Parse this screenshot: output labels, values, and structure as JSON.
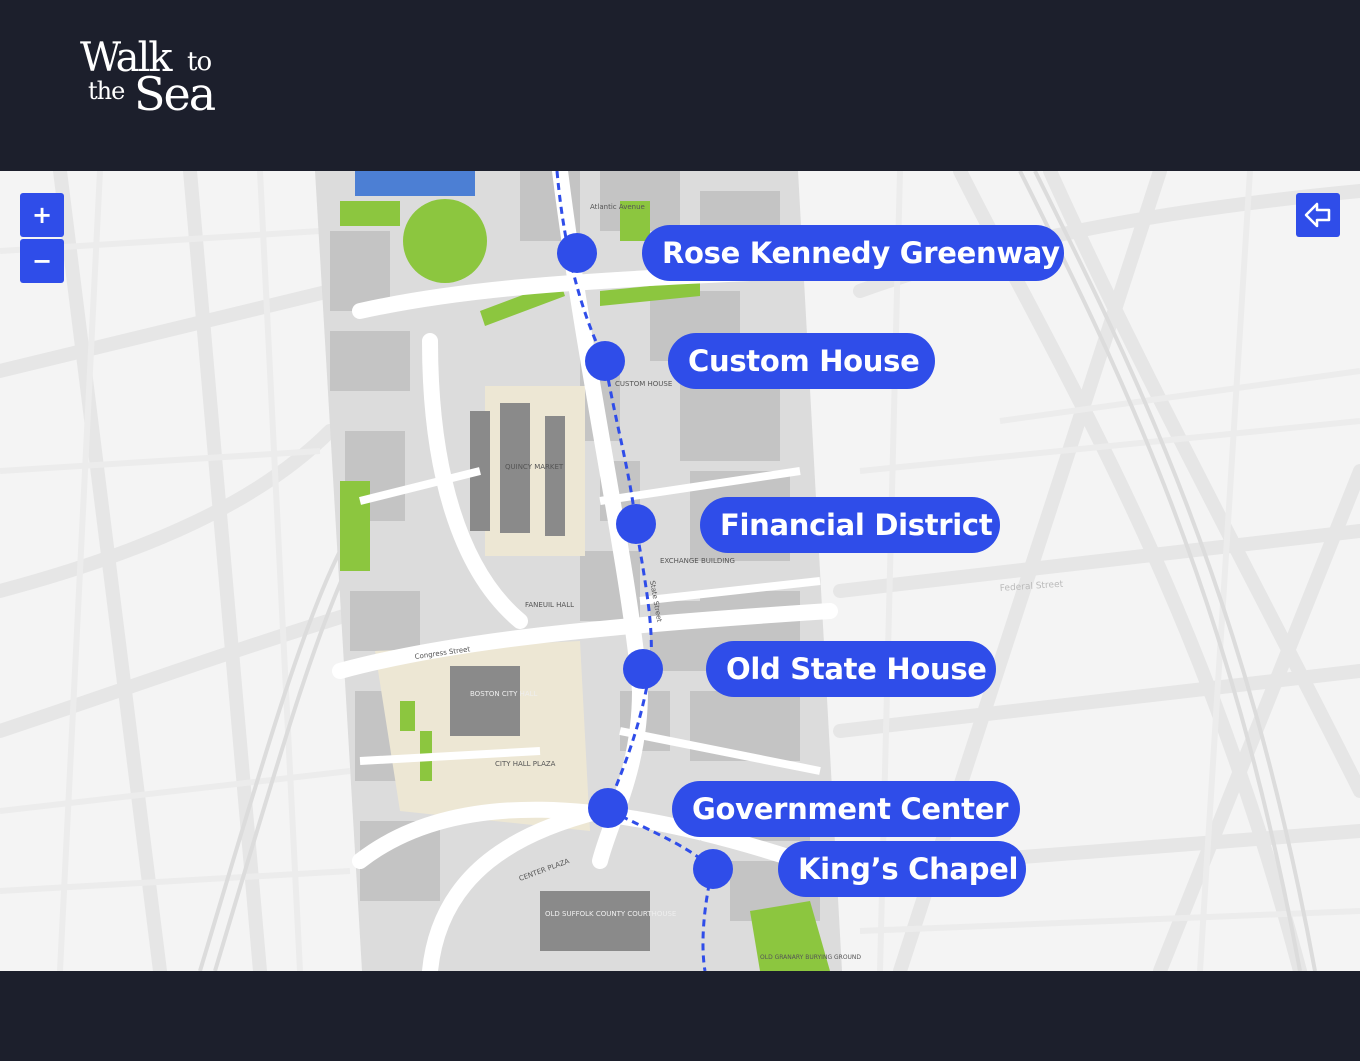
{
  "brand": {
    "logo_word_walk": "Walk",
    "logo_word_to": "to",
    "logo_word_the": "the",
    "logo_word_sea": "Sea"
  },
  "map_controls": {
    "zoom_in": "+",
    "zoom_out": "−"
  },
  "stops": [
    {
      "label": "Rose Kennedy Greenway"
    },
    {
      "label": "Custom House"
    },
    {
      "label": "Financial District"
    },
    {
      "label": "Old State House"
    },
    {
      "label": "Government Center"
    },
    {
      "label": "King’s Chapel"
    }
  ],
  "map_labels": {
    "quincy_market": "QUINCY MARKET",
    "faneuil_hall": "FANEUIL HALL",
    "boston_city_hall": "BOSTON CITY HALL",
    "city_hall_plaza": "CITY HALL PLAZA",
    "exchange_building": "EXCHANGE BUILDING",
    "custom_house": "CUSTOM HOUSE",
    "old_suffolk_courthouse": "OLD SUFFOLK COUNTY COURTHOUSE",
    "congress_street": "Congress Street",
    "state_street": "State Street",
    "atlantic_avenue": "Atlantic Avenue",
    "federal_street": "Federal Street",
    "center_plaza": "CENTER PLAZA",
    "old_granary": "OLD GRANARY BURYING GROUND"
  },
  "colors": {
    "accent": "#2f4de9",
    "header_bg": "#1c1f2c",
    "map_bg": "#f4f4f4",
    "park_green": "#8cc63f"
  }
}
